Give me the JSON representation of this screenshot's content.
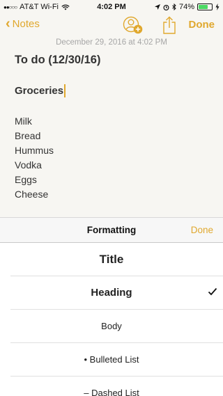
{
  "status_bar": {
    "signal": "●●○○○",
    "carrier": "AT&T Wi-Fi",
    "time": "4:02 PM",
    "battery_text": "74%",
    "battery_level": 0.74
  },
  "nav": {
    "back_label": "Notes",
    "done_label": "Done"
  },
  "note": {
    "date": "December 29, 2016 at 4:02 PM",
    "title": "To do (12/30/16)",
    "heading": "Groceries",
    "items": [
      "Milk",
      "Bread",
      "Hummus",
      "Vodka",
      "Eggs",
      "Cheese"
    ]
  },
  "formatting": {
    "header": "Formatting",
    "done_label": "Done",
    "options": [
      "Title",
      "Heading",
      "Body",
      "• Bulleted List",
      "– Dashed List"
    ],
    "selected": "Heading"
  },
  "colors": {
    "accent": "#e0a82e",
    "battery": "#4cd964"
  }
}
